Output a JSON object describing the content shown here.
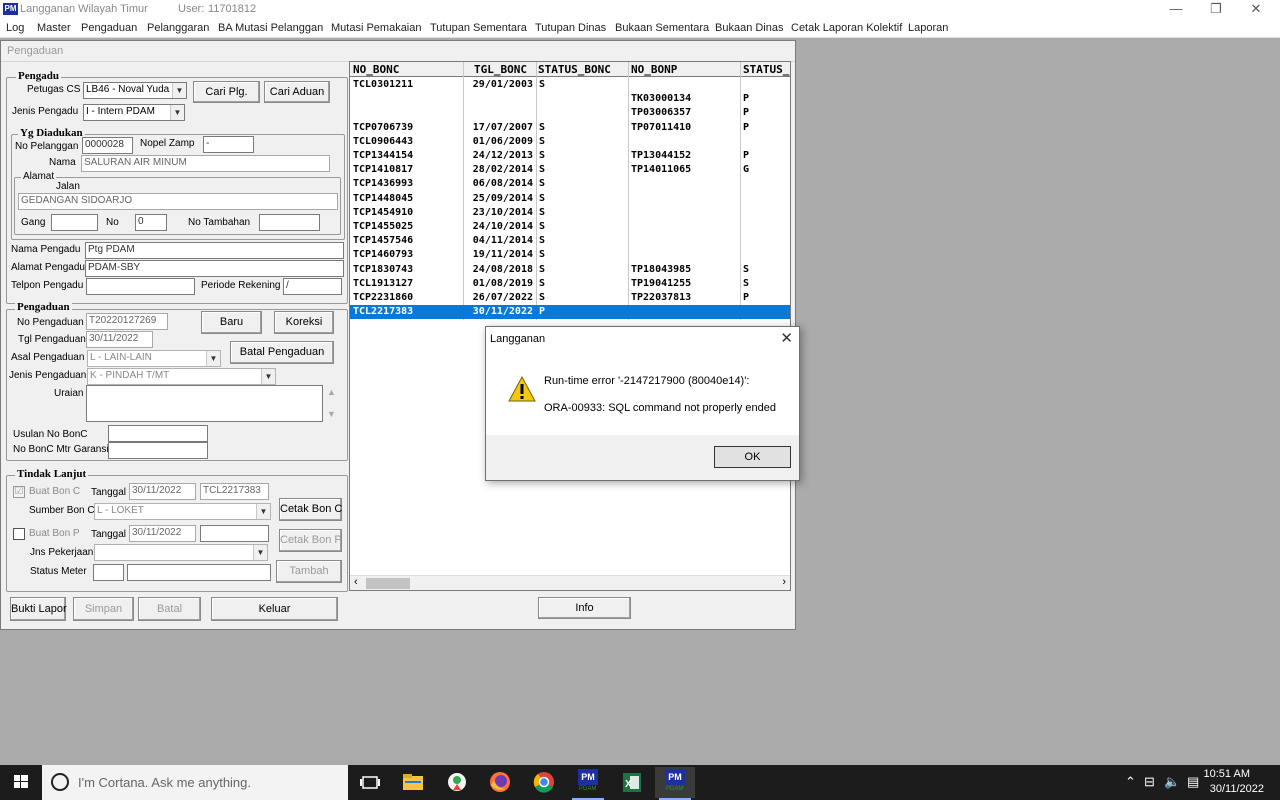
{
  "window": {
    "app_title": "Langganan Wilayah Timur",
    "user_label": "User:",
    "user_id": "11701812"
  },
  "menu": [
    "Log",
    "Master",
    "Pengaduan",
    "Pelanggaran",
    "BA Mutasi Pelanggan",
    "Mutasi Pemakaian",
    "Tutupan Sementara",
    "Tutupan Dinas",
    "Bukaan Sementara",
    "Bukaan Dinas",
    "Cetak Laporan Kolektif",
    "Laporan"
  ],
  "form": {
    "title": "Pengaduan",
    "pengadu": {
      "group_label": "Pengadu",
      "petugas_cs_label": "Petugas CS",
      "petugas_cs_value": "LB46 - Noval Yuda I",
      "cari_plg_btn": "Cari Plg.",
      "cari_aduan_btn": "Cari Aduan",
      "jenis_pengadu_label": "Jenis Pengadu",
      "jenis_pengadu_value": "I - Intern PDAM"
    },
    "yg_diadukan": {
      "group_label": "Yg Diadukan",
      "no_pelanggan_label": "No Pelanggan",
      "no_pelanggan_value": "0000028",
      "nopel_zamp_label": "Nopel Zamp",
      "nopel_zamp_value": "-",
      "nama_label": "Nama",
      "nama_value": "SALURAN AIR MINUM",
      "alamat_label": "Alamat",
      "jalan_label": "Jalan",
      "jalan_value": "GEDANGAN SIDOARJO",
      "gang_label": "Gang",
      "gang_value": "",
      "no_label": "No",
      "no_value": "0",
      "no_tambahan_label": "No Tambahan",
      "no_tambahan_value": ""
    },
    "pengadu_info": {
      "nama_label": "Nama Pengadu",
      "nama_value": "Ptg PDAM",
      "alamat_label": "Alamat Pengadu",
      "alamat_value": "PDAM-SBY",
      "telpon_label": "Telpon Pengadu",
      "telpon_value": "",
      "periode_label": "Periode Rekening",
      "periode_value": "/"
    },
    "pengaduan": {
      "group_label": "Pengaduan",
      "no_label": "No Pengaduan",
      "no_value": "T20220127269",
      "baru_btn": "Baru",
      "koreksi_btn": "Koreksi",
      "tgl_label": "Tgl Pengaduan",
      "tgl_value": "30/11/2022",
      "asal_label": "Asal Pengaduan",
      "asal_value": "L  - LAIN-LAIN",
      "batal_pengaduan_btn": "Batal Pengaduan",
      "jenis_label": "Jenis Pengaduan",
      "jenis_value": "K  - PINDAH T/MT",
      "uraian_label": "Uraian",
      "usulan_label": "Usulan No BonC",
      "usulan_value": "",
      "mtr_garansi_label": "No BonC Mtr Garansi",
      "mtr_garansi_value": ""
    },
    "tindak_lanjut": {
      "group_label": "Tindak Lanjut",
      "buat_bon_c_label": "Buat Bon C",
      "buat_bon_c_checked": "☑",
      "tanggal_label": "Tanggal",
      "bon_c_tanggal": "30/11/2022",
      "bon_c_no": "TCL2217383",
      "sumber_label": "Sumber Bon C",
      "sumber_value": "L - LOKET",
      "cetak_bon_c_btn": "Cetak Bon C",
      "buat_bon_p_label": "Buat Bon P",
      "tanggal2_label": "Tanggal",
      "bon_p_tanggal": "30/11/2022",
      "bon_p_no": "",
      "jns_pekerjaan_label": "Jns Pekerjaan",
      "jns_pekerjaan_value": "",
      "cetak_bon_p_btn": "Cetak Bon P",
      "status_meter_label": "Status Meter",
      "status_meter_code": "",
      "status_meter_desc": "",
      "tambah_btn": "Tambah"
    },
    "bottom_buttons": {
      "bukti_lapor": "Bukti Lapor",
      "simpan": "Simpan",
      "batal": "Batal",
      "keluar": "Keluar",
      "info": "Info"
    }
  },
  "grid": {
    "columns": [
      "NO_BONC",
      "TGL_BONC",
      "STATUS_BONC",
      "NO_BONP",
      "STATUS_"
    ],
    "rows": [
      [
        "TCL0301211",
        "29/01/2003",
        "S",
        "",
        ""
      ],
      [
        "",
        "",
        "",
        "TK03000134",
        "P"
      ],
      [
        "",
        "",
        "",
        "TP03006357",
        "P"
      ],
      [
        "TCP0706739",
        "17/07/2007",
        "S",
        "TP07011410",
        "P"
      ],
      [
        "TCL0906443",
        "01/06/2009",
        "S",
        "",
        ""
      ],
      [
        "TCP1344154",
        "24/12/2013",
        "S",
        "TP13044152",
        "P"
      ],
      [
        "TCP1410817",
        "28/02/2014",
        "S",
        "TP14011065",
        "G"
      ],
      [
        "TCP1436993",
        "06/08/2014",
        "S",
        "",
        ""
      ],
      [
        "TCP1448045",
        "25/09/2014",
        "S",
        "",
        ""
      ],
      [
        "TCP1454910",
        "23/10/2014",
        "S",
        "",
        ""
      ],
      [
        "TCP1455025",
        "24/10/2014",
        "S",
        "",
        ""
      ],
      [
        "TCP1457546",
        "04/11/2014",
        "S",
        "",
        ""
      ],
      [
        "TCP1460793",
        "19/11/2014",
        "S",
        "",
        ""
      ],
      [
        "TCP1830743",
        "24/08/2018",
        "S",
        "TP18043985",
        "S"
      ],
      [
        "TCL1913127",
        "01/08/2019",
        "S",
        "TP19041255",
        "S"
      ],
      [
        "TCP2231860",
        "26/07/2022",
        "S",
        "TP22037813",
        "P"
      ],
      [
        "TCL2217383",
        "30/11/2022",
        "P",
        "",
        ""
      ]
    ],
    "selected_row": 16
  },
  "dialog": {
    "title": "Langganan",
    "message_line1": "Run-time error '-2147217900 (80040e14)':",
    "message_line2": "ORA-00933: SQL command not properly ended",
    "ok_label": "OK"
  },
  "taskbar": {
    "cortana_placeholder": "I'm Cortana. Ask me anything.",
    "time": "10:51 AM",
    "date": "30/11/2022",
    "pdam_label": "PDAM"
  },
  "colors": {
    "selection": "#0a78d7",
    "taskbar": "#1c1c1c",
    "warning": "#f2c811"
  }
}
